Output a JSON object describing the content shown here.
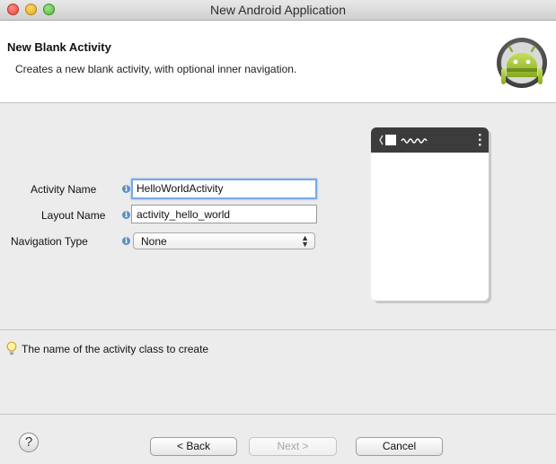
{
  "window": {
    "title": "New Android Application"
  },
  "header": {
    "title": "New Blank Activity",
    "description": "Creates a new blank activity, with optional inner navigation."
  },
  "form": {
    "activity_name": {
      "label": "Activity Name",
      "value": "HelloWorldActivity"
    },
    "layout_name": {
      "label": "Layout Name",
      "value": "activity_hello_world"
    },
    "navigation_type": {
      "label": "Navigation Type",
      "value": "None"
    }
  },
  "hint": {
    "text": "The name of the activity class to create"
  },
  "buttons": {
    "help": "?",
    "back": "< Back",
    "next": "Next >",
    "cancel": "Cancel"
  },
  "colors": {
    "focus_ring": "#7aa9e6",
    "android_green": "#a4c639",
    "info_icon": "#5c8fc4"
  }
}
